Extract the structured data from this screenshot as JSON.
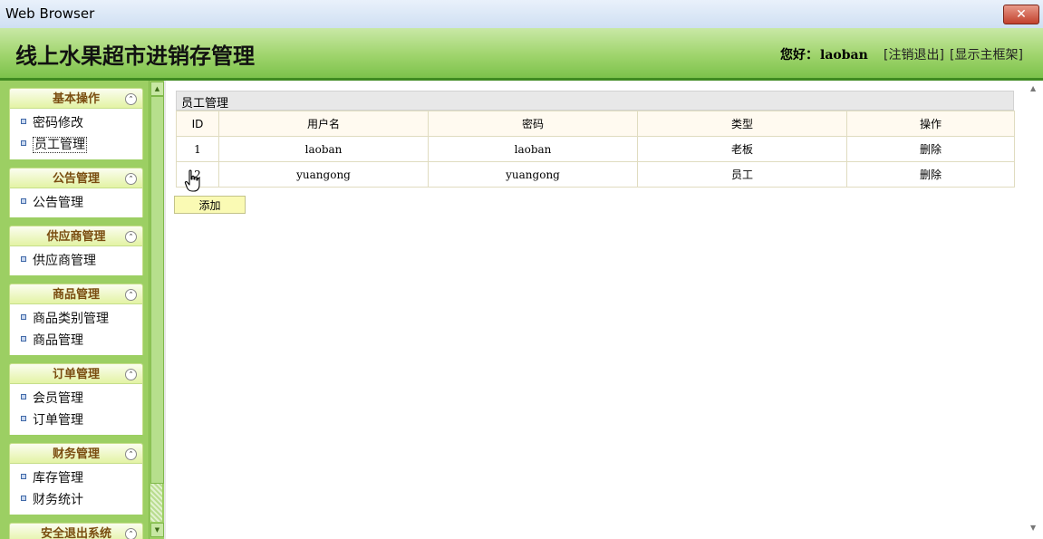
{
  "window": {
    "title": "Web Browser",
    "close_icon": "✕"
  },
  "header": {
    "app_title": "线上水果超市进销存管理",
    "greeting": "您好：",
    "username": "laoban",
    "logout_link": "[注销退出]",
    "main_frame_link": "[显示主框架]"
  },
  "sidebar": {
    "collapse_icon": "⌃",
    "groups": [
      {
        "title": "基本操作",
        "items": [
          "密码修改",
          "员工管理"
        ]
      },
      {
        "title": "公告管理",
        "items": [
          "公告管理"
        ]
      },
      {
        "title": "供应商管理",
        "items": [
          "供应商管理"
        ]
      },
      {
        "title": "商品管理",
        "items": [
          "商品类别管理",
          "商品管理"
        ]
      },
      {
        "title": "订单管理",
        "items": [
          "会员管理",
          "订单管理"
        ]
      },
      {
        "title": "财务管理",
        "items": [
          "库存管理",
          "财务统计"
        ]
      },
      {
        "title": "安全退出系统",
        "items": []
      }
    ]
  },
  "panel": {
    "title": "员工管理",
    "columns": [
      "ID",
      "用户名",
      "密码",
      "类型",
      "操作"
    ],
    "rows": [
      {
        "id": "1",
        "username": "laoban",
        "password": "laoban",
        "type": "老板",
        "action": "删除"
      },
      {
        "id": "2",
        "username": "yuangong",
        "password": "yuangong",
        "type": "员工",
        "action": "删除"
      }
    ],
    "add_label": "添加"
  },
  "colors": {
    "header_green": "#9fd46c",
    "sidebar_green": "#9ccf63",
    "menu_title": "#7a4d10",
    "add_button": "#fafab4"
  }
}
